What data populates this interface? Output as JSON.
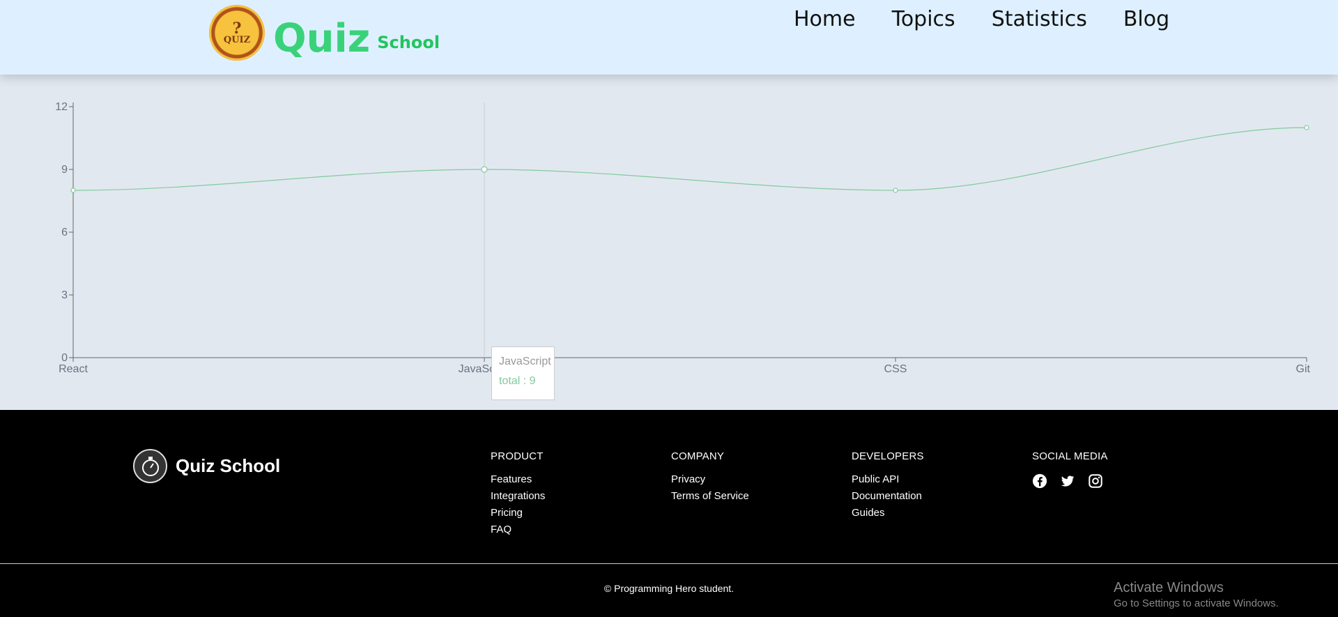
{
  "header": {
    "logo_lines": [
      "?",
      "QUIZ"
    ],
    "brand_main": "Quiz",
    "brand_sub": "School",
    "nav": [
      "Home",
      "Topics",
      "Statistics",
      "Blog"
    ]
  },
  "chart_data": {
    "type": "line",
    "categories": [
      "React",
      "JavaScript",
      "CSS",
      "Git"
    ],
    "series": [
      {
        "name": "total",
        "values": [
          8,
          9,
          8,
          11
        ]
      }
    ],
    "yticks": [
      0,
      3,
      6,
      9,
      12
    ],
    "ylim": [
      0,
      12
    ],
    "line_color": "#82ca9d",
    "tooltip": {
      "label": "JavaScript",
      "value_text": "total : 9"
    }
  },
  "footer": {
    "brand": "Quiz School",
    "columns": [
      {
        "title": "PRODUCT",
        "links": [
          "Features",
          "Integrations",
          "Pricing",
          "FAQ"
        ]
      },
      {
        "title": "COMPANY",
        "links": [
          "Privacy",
          "Terms of Service"
        ]
      },
      {
        "title": "DEVELOPERS",
        "links": [
          "Public API",
          "Documentation",
          "Guides"
        ]
      }
    ],
    "social_title": "SOCIAL MEDIA",
    "social_icons": [
      "facebook-icon",
      "twitter-icon",
      "instagram-icon"
    ],
    "copyright": "© Programming Hero student."
  },
  "watermark": {
    "line1": "Activate Windows",
    "line2": "Go to Settings to activate Windows."
  }
}
